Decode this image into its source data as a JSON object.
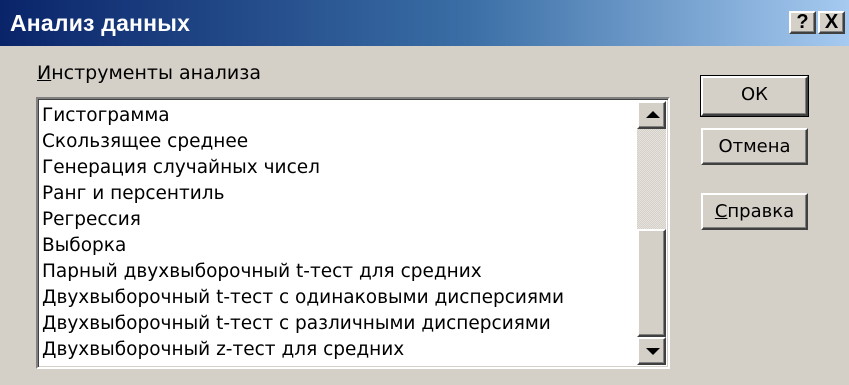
{
  "window": {
    "title": "Анализ данных",
    "help_button": "?",
    "close_button": "X"
  },
  "tools_group": {
    "label_accel": "И",
    "label_rest": "нструменты анализа",
    "items": [
      "Гистограмма",
      "Скользящее среднее",
      "Генерация случайных чисел",
      "Ранг и персентиль",
      "Регрессия",
      "Выборка",
      "Парный двухвыборочный t-тест для средних",
      "Двухвыборочный t-тест с одинаковыми дисперсиями",
      "Двухвыборочный t-тест с различными дисперсиями",
      "Двухвыборочный z-тест для средних"
    ]
  },
  "buttons": {
    "ok": "ОК",
    "cancel": "Отмена",
    "help_accel": "С",
    "help_rest": "правка"
  },
  "colors": {
    "titlebar_start": "#0a246a",
    "titlebar_end": "#a6caf0",
    "face": "#d4d0c8"
  }
}
